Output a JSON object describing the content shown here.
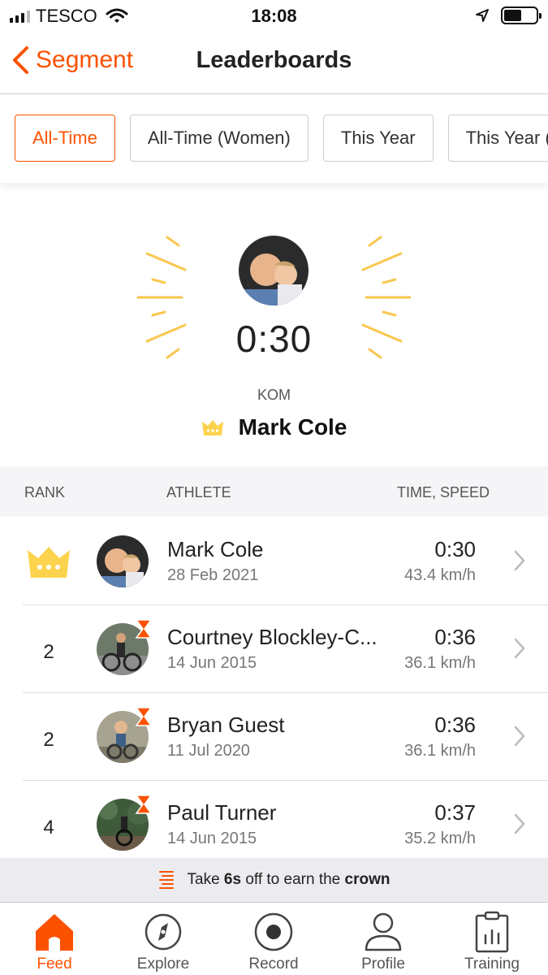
{
  "status_bar": {
    "carrier": "TESCO",
    "time": "18:08"
  },
  "nav": {
    "back_label": "Segment",
    "title": "Leaderboards"
  },
  "filters": [
    {
      "label": "All-Time",
      "active": true
    },
    {
      "label": "All-Time (Women)",
      "active": false
    },
    {
      "label": "This Year",
      "active": false
    },
    {
      "label": "This Year (Wo",
      "active": false
    }
  ],
  "hero": {
    "time": "0:30",
    "kom_label": "KOM",
    "name": "Mark Cole"
  },
  "table_header": {
    "rank": "RANK",
    "athlete": "ATHLETE",
    "time_speed": "TIME, SPEED"
  },
  "rows": [
    {
      "rank": "",
      "crown": true,
      "name": "Mark Cole",
      "date": "28 Feb 2021",
      "time": "0:30",
      "speed": "43.4 km/h",
      "badge": false
    },
    {
      "rank": "2",
      "crown": false,
      "name": "Courtney Blockley-C...",
      "date": "14 Jun 2015",
      "time": "0:36",
      "speed": "36.1 km/h",
      "badge": true
    },
    {
      "rank": "2",
      "crown": false,
      "name": "Bryan Guest",
      "date": "11 Jul 2020",
      "time": "0:36",
      "speed": "36.1 km/h",
      "badge": true
    },
    {
      "rank": "4",
      "crown": false,
      "name": "Paul Turner",
      "date": "14 Jun 2015",
      "time": "0:37",
      "speed": "35.2 km/h",
      "badge": true
    }
  ],
  "banner": {
    "prefix": "Take ",
    "bold1": "6s",
    "middle": " off to earn the ",
    "bold2": "crown"
  },
  "tabs": [
    {
      "label": "Feed",
      "icon": "home-icon",
      "active": true
    },
    {
      "label": "Explore",
      "icon": "compass-icon",
      "active": false
    },
    {
      "label": "Record",
      "icon": "record-icon",
      "active": false
    },
    {
      "label": "Profile",
      "icon": "person-icon",
      "active": false
    },
    {
      "label": "Training",
      "icon": "clipboard-chart-icon",
      "active": false
    }
  ],
  "colors": {
    "accent": "#fc5200",
    "crown": "#fcd34d",
    "rays": "#f9c74f"
  }
}
